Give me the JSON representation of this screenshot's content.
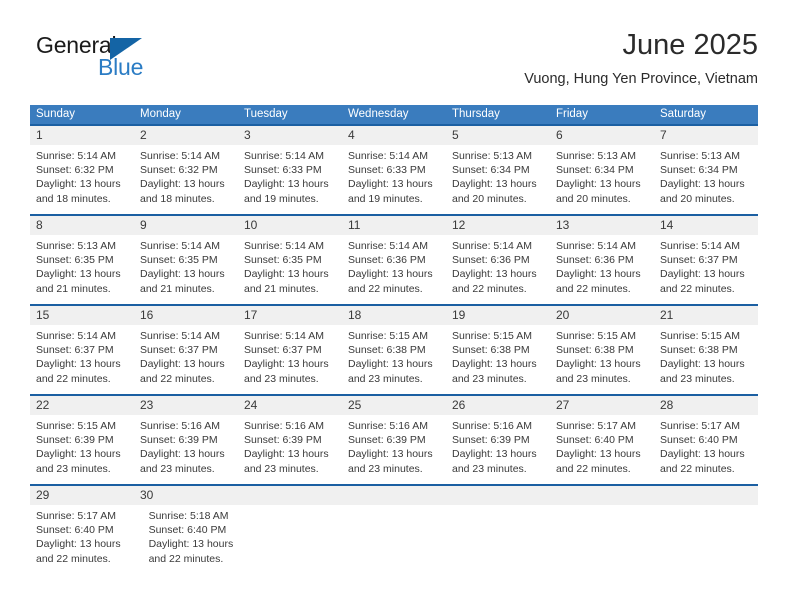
{
  "logo": {
    "primary_text": "General",
    "secondary_text": "Blue",
    "triangle_icon": "triangle-icon",
    "primary_color": "#1a1a1a",
    "secondary_color": "#2b7cc4",
    "triangle_color": "#1464a5"
  },
  "header": {
    "title": "June 2025",
    "subtitle": "Vuong, Hung Yen Province, Vietnam"
  },
  "colors": {
    "header_row_bg": "#3a7cbe",
    "header_row_text": "#ffffff",
    "week_rule": "#1b5fa2",
    "daynum_band_bg": "#f0f0f0",
    "body_text": "#3a3a3a"
  },
  "calendar": {
    "weekdays": [
      "Sunday",
      "Monday",
      "Tuesday",
      "Wednesday",
      "Thursday",
      "Friday",
      "Saturday"
    ],
    "weeks": [
      {
        "days": [
          {
            "num": "1",
            "sunrise": "Sunrise: 5:14 AM",
            "sunset": "Sunset: 6:32 PM",
            "daylight_1": "Daylight: 13 hours",
            "daylight_2": "and 18 minutes."
          },
          {
            "num": "2",
            "sunrise": "Sunrise: 5:14 AM",
            "sunset": "Sunset: 6:32 PM",
            "daylight_1": "Daylight: 13 hours",
            "daylight_2": "and 18 minutes."
          },
          {
            "num": "3",
            "sunrise": "Sunrise: 5:14 AM",
            "sunset": "Sunset: 6:33 PM",
            "daylight_1": "Daylight: 13 hours",
            "daylight_2": "and 19 minutes."
          },
          {
            "num": "4",
            "sunrise": "Sunrise: 5:14 AM",
            "sunset": "Sunset: 6:33 PM",
            "daylight_1": "Daylight: 13 hours",
            "daylight_2": "and 19 minutes."
          },
          {
            "num": "5",
            "sunrise": "Sunrise: 5:13 AM",
            "sunset": "Sunset: 6:34 PM",
            "daylight_1": "Daylight: 13 hours",
            "daylight_2": "and 20 minutes."
          },
          {
            "num": "6",
            "sunrise": "Sunrise: 5:13 AM",
            "sunset": "Sunset: 6:34 PM",
            "daylight_1": "Daylight: 13 hours",
            "daylight_2": "and 20 minutes."
          },
          {
            "num": "7",
            "sunrise": "Sunrise: 5:13 AM",
            "sunset": "Sunset: 6:34 PM",
            "daylight_1": "Daylight: 13 hours",
            "daylight_2": "and 20 minutes."
          }
        ]
      },
      {
        "days": [
          {
            "num": "8",
            "sunrise": "Sunrise: 5:13 AM",
            "sunset": "Sunset: 6:35 PM",
            "daylight_1": "Daylight: 13 hours",
            "daylight_2": "and 21 minutes."
          },
          {
            "num": "9",
            "sunrise": "Sunrise: 5:14 AM",
            "sunset": "Sunset: 6:35 PM",
            "daylight_1": "Daylight: 13 hours",
            "daylight_2": "and 21 minutes."
          },
          {
            "num": "10",
            "sunrise": "Sunrise: 5:14 AM",
            "sunset": "Sunset: 6:35 PM",
            "daylight_1": "Daylight: 13 hours",
            "daylight_2": "and 21 minutes."
          },
          {
            "num": "11",
            "sunrise": "Sunrise: 5:14 AM",
            "sunset": "Sunset: 6:36 PM",
            "daylight_1": "Daylight: 13 hours",
            "daylight_2": "and 22 minutes."
          },
          {
            "num": "12",
            "sunrise": "Sunrise: 5:14 AM",
            "sunset": "Sunset: 6:36 PM",
            "daylight_1": "Daylight: 13 hours",
            "daylight_2": "and 22 minutes."
          },
          {
            "num": "13",
            "sunrise": "Sunrise: 5:14 AM",
            "sunset": "Sunset: 6:36 PM",
            "daylight_1": "Daylight: 13 hours",
            "daylight_2": "and 22 minutes."
          },
          {
            "num": "14",
            "sunrise": "Sunrise: 5:14 AM",
            "sunset": "Sunset: 6:37 PM",
            "daylight_1": "Daylight: 13 hours",
            "daylight_2": "and 22 minutes."
          }
        ]
      },
      {
        "days": [
          {
            "num": "15",
            "sunrise": "Sunrise: 5:14 AM",
            "sunset": "Sunset: 6:37 PM",
            "daylight_1": "Daylight: 13 hours",
            "daylight_2": "and 22 minutes."
          },
          {
            "num": "16",
            "sunrise": "Sunrise: 5:14 AM",
            "sunset": "Sunset: 6:37 PM",
            "daylight_1": "Daylight: 13 hours",
            "daylight_2": "and 22 minutes."
          },
          {
            "num": "17",
            "sunrise": "Sunrise: 5:14 AM",
            "sunset": "Sunset: 6:37 PM",
            "daylight_1": "Daylight: 13 hours",
            "daylight_2": "and 23 minutes."
          },
          {
            "num": "18",
            "sunrise": "Sunrise: 5:15 AM",
            "sunset": "Sunset: 6:38 PM",
            "daylight_1": "Daylight: 13 hours",
            "daylight_2": "and 23 minutes."
          },
          {
            "num": "19",
            "sunrise": "Sunrise: 5:15 AM",
            "sunset": "Sunset: 6:38 PM",
            "daylight_1": "Daylight: 13 hours",
            "daylight_2": "and 23 minutes."
          },
          {
            "num": "20",
            "sunrise": "Sunrise: 5:15 AM",
            "sunset": "Sunset: 6:38 PM",
            "daylight_1": "Daylight: 13 hours",
            "daylight_2": "and 23 minutes."
          },
          {
            "num": "21",
            "sunrise": "Sunrise: 5:15 AM",
            "sunset": "Sunset: 6:38 PM",
            "daylight_1": "Daylight: 13 hours",
            "daylight_2": "and 23 minutes."
          }
        ]
      },
      {
        "days": [
          {
            "num": "22",
            "sunrise": "Sunrise: 5:15 AM",
            "sunset": "Sunset: 6:39 PM",
            "daylight_1": "Daylight: 13 hours",
            "daylight_2": "and 23 minutes."
          },
          {
            "num": "23",
            "sunrise": "Sunrise: 5:16 AM",
            "sunset": "Sunset: 6:39 PM",
            "daylight_1": "Daylight: 13 hours",
            "daylight_2": "and 23 minutes."
          },
          {
            "num": "24",
            "sunrise": "Sunrise: 5:16 AM",
            "sunset": "Sunset: 6:39 PM",
            "daylight_1": "Daylight: 13 hours",
            "daylight_2": "and 23 minutes."
          },
          {
            "num": "25",
            "sunrise": "Sunrise: 5:16 AM",
            "sunset": "Sunset: 6:39 PM",
            "daylight_1": "Daylight: 13 hours",
            "daylight_2": "and 23 minutes."
          },
          {
            "num": "26",
            "sunrise": "Sunrise: 5:16 AM",
            "sunset": "Sunset: 6:39 PM",
            "daylight_1": "Daylight: 13 hours",
            "daylight_2": "and 23 minutes."
          },
          {
            "num": "27",
            "sunrise": "Sunrise: 5:17 AM",
            "sunset": "Sunset: 6:40 PM",
            "daylight_1": "Daylight: 13 hours",
            "daylight_2": "and 22 minutes."
          },
          {
            "num": "28",
            "sunrise": "Sunrise: 5:17 AM",
            "sunset": "Sunset: 6:40 PM",
            "daylight_1": "Daylight: 13 hours",
            "daylight_2": "and 22 minutes."
          }
        ]
      },
      {
        "days": [
          {
            "num": "29",
            "sunrise": "Sunrise: 5:17 AM",
            "sunset": "Sunset: 6:40 PM",
            "daylight_1": "Daylight: 13 hours",
            "daylight_2": "and 22 minutes."
          },
          {
            "num": "30",
            "sunrise": "Sunrise: 5:18 AM",
            "sunset": "Sunset: 6:40 PM",
            "daylight_1": "Daylight: 13 hours",
            "daylight_2": "and 22 minutes."
          },
          {
            "num": "",
            "sunrise": "",
            "sunset": "",
            "daylight_1": "",
            "daylight_2": ""
          },
          {
            "num": "",
            "sunrise": "",
            "sunset": "",
            "daylight_1": "",
            "daylight_2": ""
          },
          {
            "num": "",
            "sunrise": "",
            "sunset": "",
            "daylight_1": "",
            "daylight_2": ""
          },
          {
            "num": "",
            "sunrise": "",
            "sunset": "",
            "daylight_1": "",
            "daylight_2": ""
          },
          {
            "num": "",
            "sunrise": "",
            "sunset": "",
            "daylight_1": "",
            "daylight_2": ""
          }
        ]
      }
    ]
  }
}
